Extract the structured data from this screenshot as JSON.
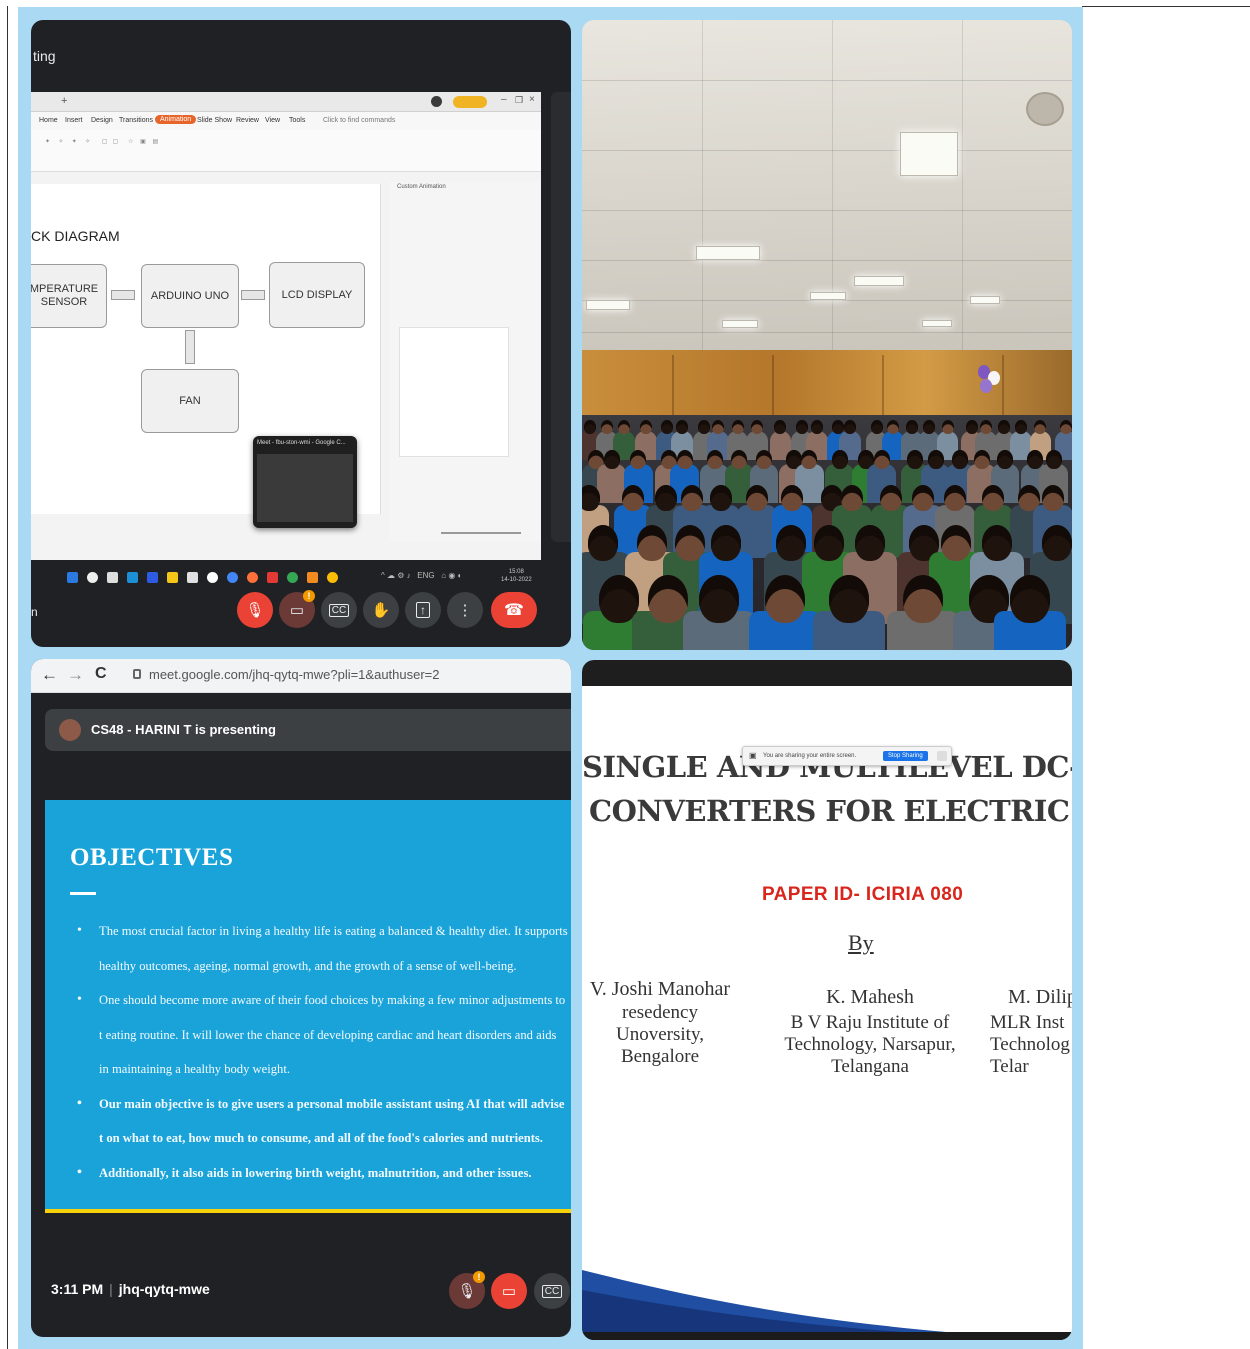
{
  "panel1": {
    "window_title": "ting",
    "menu_tabs": [
      "Home",
      "Insert",
      "Design",
      "Transitions",
      "Animation",
      "Slide Show",
      "Review",
      "View",
      "Tools"
    ],
    "search_placeholder": "Click to find commands",
    "slide": {
      "heading": "CK DIAGRAM",
      "blocks": {
        "temp": "MPERATURE\nSENSOR",
        "arduino": "ARDUINO UNO",
        "lcd": "LCD DISPLAY",
        "fan": "FAN"
      }
    },
    "side_panel_title": "Custom Animation",
    "thumb_title": "Meet - fbu-ston-wmi - Google C...",
    "clock": "15:08\n14-10-2022",
    "bottom_letter": "n",
    "badge": "!",
    "colors": {
      "end_call": "#ea4335",
      "mic_off": "#ea4335",
      "control": "#3c4043"
    }
  },
  "panel2": {
    "description_icon": "auditorium-photo"
  },
  "panel3": {
    "url": "meet.google.com/jhq-qytq-mwe?pli=1&authuser=2",
    "presenter": "CS48 - HARINI T is presenting",
    "slide": {
      "title": "OBJECTIVES",
      "bullets": [
        "The most crucial factor in living a healthy life is eating a balanced & healthy diet. It supports healthy outcomes, ageing, normal growth, and the growth of a sense of well-being.",
        "One should become more aware of their food choices by making a few minor adjustments to t eating routine. It will lower the chance of developing cardiac and heart disorders and aids in maintaining a healthy body weight.",
        "Our main objective is to give users a personal mobile assistant using AI that will advise t on what to eat, how much to consume, and all of the food's calories and nutrients.",
        "Additionally, it also aids in lowering birth weight, malnutrition, and other issues."
      ]
    },
    "time": "3:11 PM",
    "meeting_code": "jhq-qytq-mwe",
    "badge": "!"
  },
  "panel4": {
    "share_message": "You are sharing your entire screen.",
    "stop_sharing": "Stop Sharing",
    "title_line1": "SINGLE AND MULTILEVEL DC-DC  PO",
    "title_line2": "CONVERTERS FOR ELECTRIC VEHIC",
    "paper_id": "PAPER ID- ICIRIA 080",
    "by": "By",
    "authors": [
      {
        "name": "V. Joshi Manohar",
        "affiliation": "resedency Unoversity,\nBengalore"
      },
      {
        "name": "K. Mahesh",
        "affiliation": "B V Raju Institute of\nTechnology, Narsapur,\nTelangana"
      },
      {
        "name": "M. Dilip",
        "affiliation": "MLR Inst\nTechnolog\nTelar"
      }
    ]
  }
}
